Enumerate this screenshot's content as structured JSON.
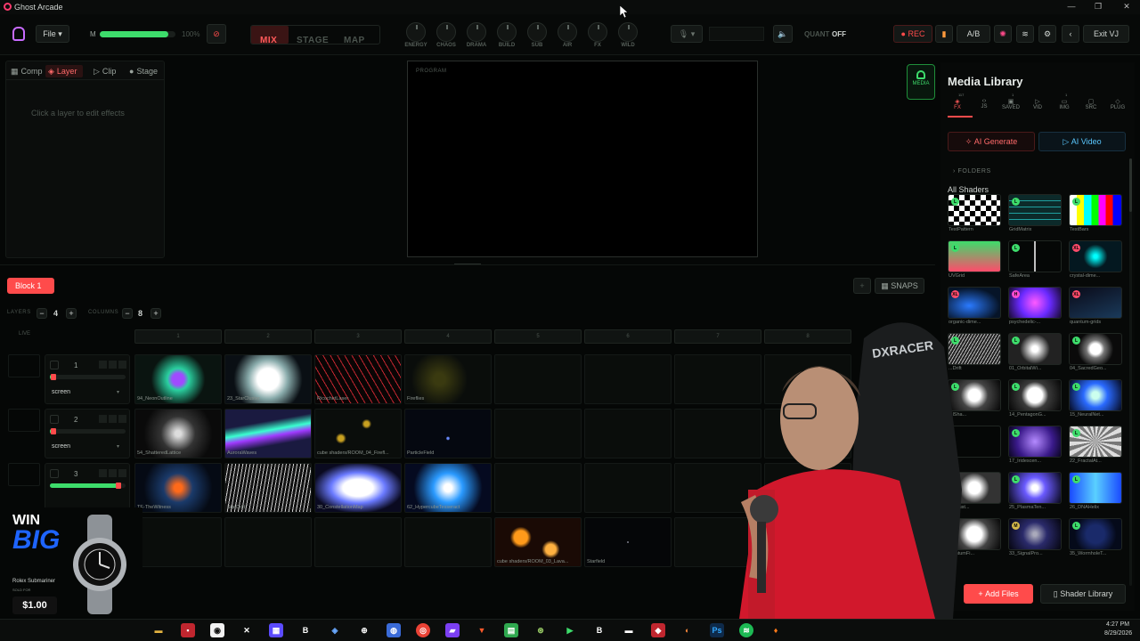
{
  "window": {
    "title": "Ghost Arcade"
  },
  "topbar": {
    "file_label": "File",
    "master_label": "M",
    "master_percent": "100%",
    "master_level": 0.9,
    "tabs": [
      {
        "label": "MIX",
        "active": true
      },
      {
        "label": "STAGE",
        "active": false
      },
      {
        "label": "MAP",
        "active": false
      }
    ],
    "knobs": [
      "ENERGY",
      "CHAOS",
      "DRAMA",
      "BUILD",
      "SUB",
      "AIR",
      "FX",
      "WILD"
    ],
    "quant_label": "QUANT",
    "quant_value": "OFF",
    "rec_label": "● REC",
    "ab_label": "A/B",
    "exit_label": "Exit VJ"
  },
  "left_panel": {
    "tabs": [
      {
        "label": "Comp",
        "icon": "grid-icon"
      },
      {
        "label": "Layer",
        "icon": "layers-icon",
        "active": true
      },
      {
        "label": "Clip",
        "icon": "play-icon"
      },
      {
        "label": "Stage",
        "icon": "circle-icon"
      }
    ],
    "empty_message": "Click a layer to edit effects"
  },
  "program": {
    "label": "PROGRAM"
  },
  "media_tab": {
    "label": "MEDIA"
  },
  "media_library": {
    "title": "Media Library",
    "tabs": [
      {
        "label": "FX",
        "count": "117",
        "active": true
      },
      {
        "label": "JS"
      },
      {
        "label": "SAVED",
        "count": "1"
      },
      {
        "label": "VID"
      },
      {
        "label": "IMG",
        "count": "1"
      },
      {
        "label": "SRC"
      },
      {
        "label": "PLUG"
      }
    ],
    "ai_generate": "AI Generate",
    "ai_video": "AI Video",
    "folders_label": "FOLDERS",
    "all_shaders_label": "All Shaders",
    "shaders": [
      {
        "name": "TestPattern",
        "badge": "L"
      },
      {
        "name": "GridMatrix",
        "badge": "L"
      },
      {
        "name": "TestBars",
        "badge": "L"
      },
      {
        "name": "UVGrid",
        "badge": "L"
      },
      {
        "name": "SafeArea",
        "badge": "L"
      },
      {
        "name": "crystal-dime...",
        "badge": "XL"
      },
      {
        "name": "organic-dime...",
        "badge": "XL"
      },
      {
        "name": "psychedelic-...",
        "badge": "H"
      },
      {
        "name": "quantum-grids",
        "badge": "XL"
      },
      {
        "name": "...Drift",
        "badge": "L"
      },
      {
        "name": "01_OrbitalWi...",
        "badge": "L"
      },
      {
        "name": "04_SacredGeo...",
        "badge": "L"
      },
      {
        "name": "...lSha...",
        "badge": "L"
      },
      {
        "name": "14_PentagonG...",
        "badge": "L"
      },
      {
        "name": "15_NeuralNet...",
        "badge": "L"
      },
      {
        "name": "",
        "badge": ""
      },
      {
        "name": "17_Iridescen...",
        "badge": "L"
      },
      {
        "name": "22_FractalAt...",
        "badge": "L"
      },
      {
        "name": "...rClust...",
        "badge": ""
      },
      {
        "name": "25_PlasmaTen...",
        "badge": "L"
      },
      {
        "name": "26_DNAHelix",
        "badge": "L"
      },
      {
        "name": "...untumFi...",
        "badge": ""
      },
      {
        "name": "33_SignalPro...",
        "badge": "M"
      },
      {
        "name": "35_WormholeT...",
        "badge": "L"
      }
    ],
    "add_files": "Add Files",
    "shader_library": "Shader Library"
  },
  "deck": {
    "block_label": "Block 1",
    "snaps_label": "SNAPS",
    "layers_label": "LAYERS",
    "layers_value": "4",
    "columns_label": "COLUMNS",
    "columns_value": "8",
    "live_label": "LIVE",
    "columns": [
      "1",
      "2",
      "3",
      "4",
      "5",
      "6",
      "7",
      "8"
    ],
    "layers": [
      {
        "num": "1",
        "blend": "screen",
        "level": 0.05,
        "clips": [
          "94_NeonOutline",
          "23_StarCluster",
          "RicochetLaser",
          "Fireflies",
          "",
          "",
          "",
          ""
        ]
      },
      {
        "num": "2",
        "blend": "screen",
        "level": 0.05,
        "clips": [
          "54_ShatteredLattice",
          "AuroraWaves",
          "cube shaders/ROOM_04_Firefl...",
          "ParticleField",
          "",
          "",
          "",
          ""
        ]
      },
      {
        "num": "3",
        "blend": "",
        "level": 0.9,
        "clips": [
          "TE-TheWitness",
          "StarDrift",
          "30_ConstellationMap",
          "62_HypercubeTesseract",
          "",
          "",
          "",
          ""
        ]
      },
      {
        "num": "",
        "blend": "",
        "level": 0,
        "clips": [
          "",
          "",
          "",
          "",
          "cube shaders/ROOM_03_Lava...",
          "Starfield",
          "",
          ""
        ]
      }
    ]
  },
  "ad": {
    "line1": "WIN",
    "line2": "BIG",
    "product": "Rolex Submariner",
    "sold": "SOLD FOR",
    "price": "$1.00"
  },
  "taskbar": {
    "time": "4:27 PM",
    "date": "8/29/2026"
  },
  "colors": {
    "accent_red": "#ff4b4b",
    "accent_green": "#3ddc6b",
    "panel": "#0b0d0c",
    "bg": "#050706"
  }
}
